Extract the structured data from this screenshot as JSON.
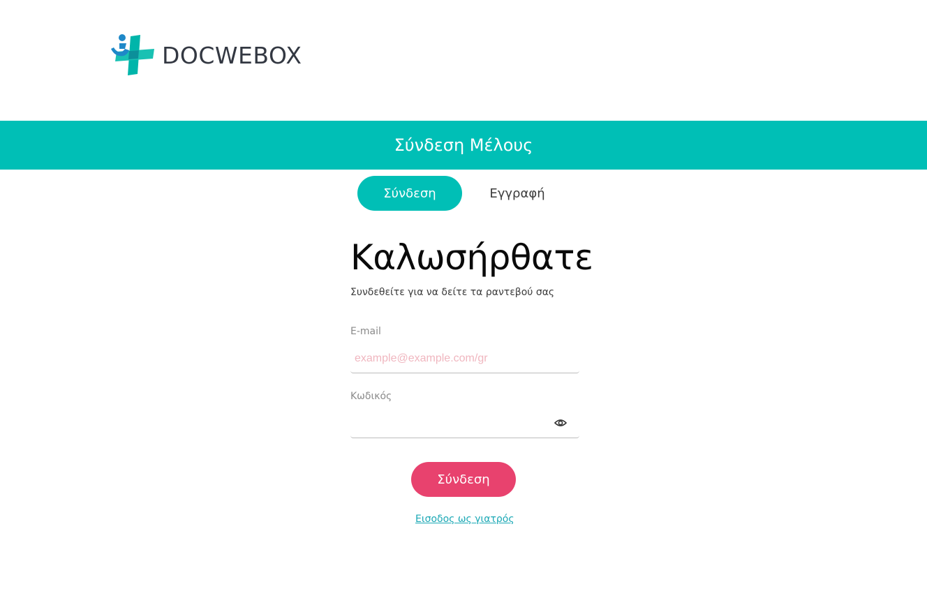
{
  "brand": {
    "name": "DOCWEBOX",
    "colors": {
      "teal": "#00bfb6",
      "pink": "#e8426e",
      "logo_blue": "#1e88c8"
    }
  },
  "banner": {
    "title": "Σύνδεση Μέλους"
  },
  "tabs": [
    {
      "label": "Σύνδεση",
      "active": true
    },
    {
      "label": "Εγγραφή",
      "active": false
    }
  ],
  "form": {
    "heading": "Καλωσήρθατε",
    "subtitle": "Συνδεθείτε για να δείτε τα ραντεβού σας",
    "email": {
      "label": "E-mail",
      "value": "",
      "placeholder": "example@example.com/gr"
    },
    "password": {
      "label": "Κωδικός",
      "value": "",
      "toggle_icon": "eye-icon"
    },
    "submit_label": "Σύνδεση",
    "doctor_link": "Εισοδος ως γιατρός"
  }
}
